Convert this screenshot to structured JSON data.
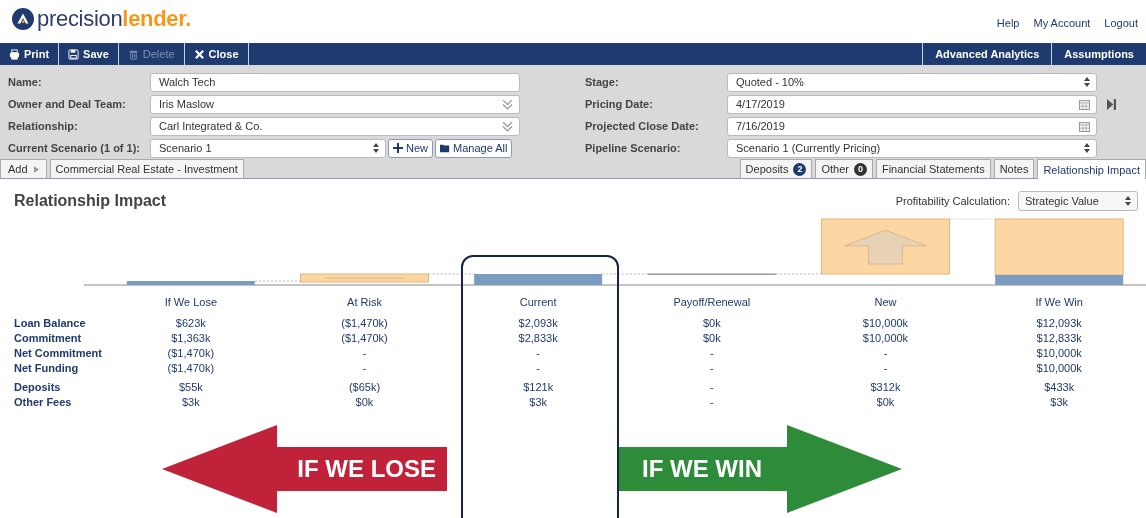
{
  "logo": {
    "main": "precision",
    "accent": "lender."
  },
  "top_links": [
    "Help",
    "My Account",
    "Logout"
  ],
  "toolbar": {
    "left": [
      {
        "label": "Print",
        "kind": "print",
        "disabled": false
      },
      {
        "label": "Save",
        "kind": "save",
        "disabled": false
      },
      {
        "label": "Delete",
        "kind": "delete",
        "disabled": true
      },
      {
        "label": "Close",
        "kind": "close",
        "disabled": false
      }
    ],
    "right": [
      "Advanced Analytics",
      "Assumptions"
    ]
  },
  "form_left": [
    {
      "label": "Name:",
      "value": "Walch Tech",
      "kind": "text"
    },
    {
      "label": "Owner and Deal Team:",
      "value": "Iris Maslow",
      "kind": "combo"
    },
    {
      "label": "Relationship:",
      "value": "Carl Integrated & Co.",
      "kind": "combo"
    },
    {
      "label": "Current Scenario (1 of 1):",
      "value": "Scenario 1",
      "kind": "select",
      "buttons": [
        "New",
        "Manage All"
      ]
    }
  ],
  "form_right": [
    {
      "label": "Stage:",
      "value": "Quoted - 10%",
      "kind": "select"
    },
    {
      "label": "Pricing Date:",
      "value": "4/17/2019",
      "kind": "date"
    },
    {
      "label": "Projected Close Date:",
      "value": "7/16/2019",
      "kind": "date"
    },
    {
      "label": "Pipeline Scenario:",
      "value": "Scenario 1 (Currently Pricing)",
      "kind": "select"
    }
  ],
  "tabs_left": [
    {
      "label": "Add",
      "kind": "add"
    },
    {
      "label": "Commercial Real Estate - Investment",
      "kind": "tab"
    }
  ],
  "tabs_right": [
    {
      "label": "Deposits",
      "badge": "2",
      "color": "#1f3a6e",
      "selected": false
    },
    {
      "label": "Other",
      "badge": "0",
      "color": "#333333",
      "selected": false
    },
    {
      "label": "Financial Statements",
      "selected": false
    },
    {
      "label": "Notes",
      "selected": false
    },
    {
      "label": "Relationship Impact",
      "selected": true
    }
  ],
  "section_title": "Relationship Impact",
  "profitability": {
    "label": "Profitability Calculation:",
    "value": "Strategic Value"
  },
  "columns": [
    {
      "name": "If We Lose",
      "highlighted": false
    },
    {
      "name": "At Risk",
      "highlighted": false
    },
    {
      "name": "Current",
      "highlighted": true
    },
    {
      "name": "Payoff/Renewal",
      "highlighted": false
    },
    {
      "name": "New",
      "highlighted": false
    },
    {
      "name": "If We Win",
      "highlighted": false
    }
  ],
  "rows": [
    {
      "label": "Loan Balance",
      "values": [
        "$623k",
        "($1,470k)",
        "$2,093k",
        "$0k",
        "$10,000k",
        "$12,093k"
      ]
    },
    {
      "label": "Commitment",
      "values": [
        "$1,363k",
        "($1,470k)",
        "$2,833k",
        "$0k",
        "$10,000k",
        "$12,833k"
      ]
    },
    {
      "label": "Net Commitment",
      "values": [
        "($1,470k)",
        "-",
        "-",
        "-",
        "-",
        "$10,000k"
      ]
    },
    {
      "label": "Net Funding",
      "values": [
        "($1,470k)",
        "-",
        "-",
        "-",
        "-",
        "$10,000k"
      ]
    },
    {
      "label": "Deposits",
      "values": [
        "$55k",
        "($65k)",
        "$121k",
        "-",
        "$312k",
        "$433k"
      ]
    },
    {
      "label": "Other Fees",
      "values": [
        "$3k",
        "$0k",
        "$3k",
        "-",
        "$0k",
        "$3k"
      ]
    }
  ],
  "arrows": [
    {
      "label": "IF WE LOSE",
      "kind": "left",
      "color": "#c0223a"
    },
    {
      "label": "IF WE WIN",
      "kind": "right",
      "color": "#2e8b3a"
    }
  ]
}
